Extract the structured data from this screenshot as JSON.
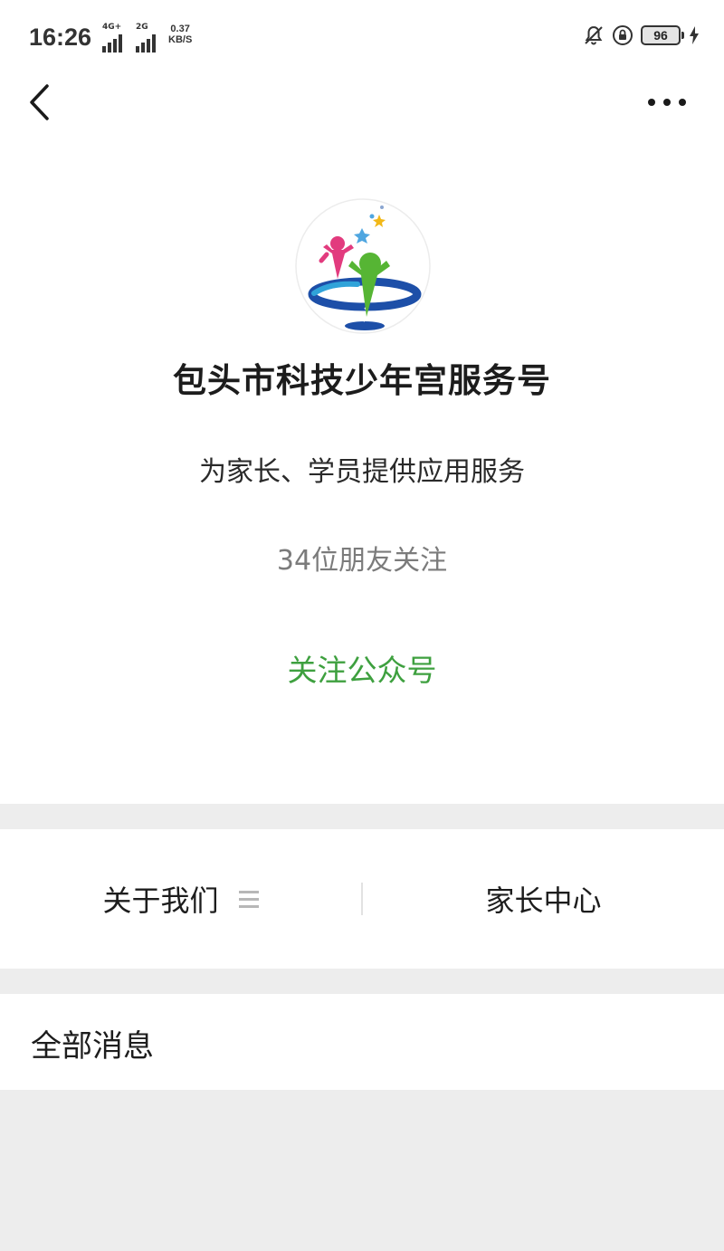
{
  "status_bar": {
    "time": "16:26",
    "network_1": "4G+",
    "network_2": "2G",
    "speed_value": "0.37",
    "speed_unit": "KB/S",
    "battery": "96"
  },
  "account": {
    "name": "包头市科技少年宫服务号",
    "description": "为家长、学员提供应用服务",
    "followers": "34位朋友关注",
    "follow_label": "关注公众号"
  },
  "menu": {
    "items": [
      {
        "label": "关于我们",
        "icon": "menu-lines-icon"
      },
      {
        "label": "家长中心"
      }
    ]
  },
  "messages": {
    "title": "全部消息"
  },
  "colors": {
    "accent_green": "#3ea03f",
    "page_background": "#ededed"
  }
}
